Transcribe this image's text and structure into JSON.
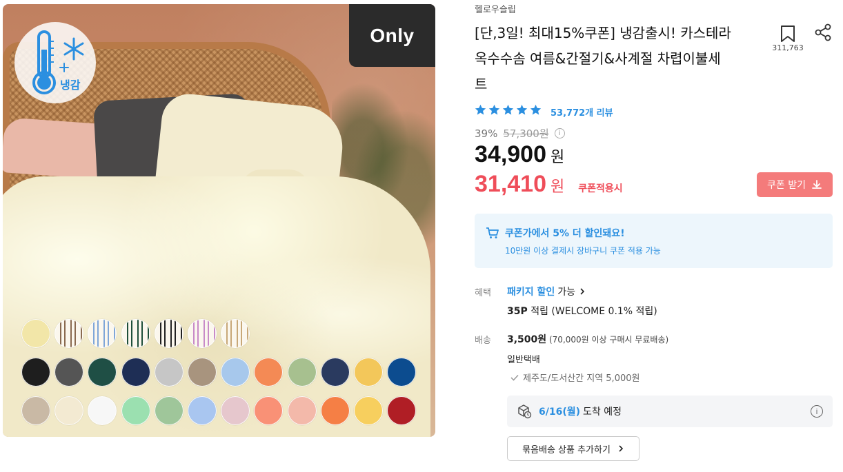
{
  "badges": {
    "cool_label": "냉감",
    "only_label": "Only"
  },
  "swatches": {
    "row1": [
      "#f2e6a8",
      "stripe-brown",
      "stripe-blue",
      "stripe-green",
      "stripe-black",
      "stripe-pink",
      "stripe-beige"
    ],
    "row2": [
      "#1e1e1e",
      "#555555",
      "#1f4f45",
      "#1e2e55",
      "#c6c6c6",
      "#a8947e",
      "#a7c8ec",
      "#f48a55",
      "#a7c08f",
      "#2a3a5f",
      "#f3c75a",
      "#0c4c8f"
    ],
    "row3": [
      "#c9b9a5",
      "#f3ead2",
      "#f7f7f7",
      "#9be0b0",
      "#9fc69a",
      "#a9c6f0",
      "#e6c7cd",
      "#f99176",
      "#f3b9aa",
      "#f57f45",
      "#f7cf5e",
      "#b01e25"
    ]
  },
  "product": {
    "seller": "헬로우슬립",
    "title_line1": "[단,3일! 최대15%쿠폰] 냉감출시! 카스테라",
    "title_line2": "옥수수솜 여름&간절기&사계절 차렵이불세",
    "title_line3": "트",
    "bookmark_count": "311,763",
    "rating_stars": 5,
    "review_count": "53,772개 리뷰",
    "discount_rate": "39%",
    "original_price": "57,300원",
    "price": "34,900",
    "price_unit": "원",
    "coupon_price": "31,410",
    "coupon_price_unit": "원",
    "coupon_price_label": "쿠폰적용시",
    "coupon_button": "쿠폰 받기"
  },
  "coupon_info": {
    "headline": "쿠폰가에서 5% 더 할인돼요!",
    "subline": "10만원 이상 결제시 장바구니 쿠폰 적용 가능"
  },
  "benefits": {
    "label": "혜택",
    "package_link": "패키지 할인",
    "package_suffix": "가능",
    "points_bold": "35P",
    "points_rest": " 적립 (WELCOME 0.1% 적립)"
  },
  "shipping": {
    "label": "배송",
    "fee": "3,500원",
    "fee_note": " (70,000원 이상 구매시 무료배송)",
    "method": "일반택배",
    "extra_region": "제주도/도서산간 지역 5,000원",
    "arrival_date": "6/16(월)",
    "arrival_text": "도착 예정",
    "bundle_button": "묶음배송 상품 추가하기"
  },
  "colors": {
    "accent_blue": "#2b8fe0",
    "accent_red": "#ef4d59",
    "coupon_button_bg": "#f47b7b",
    "star": "#2b8fe0"
  }
}
